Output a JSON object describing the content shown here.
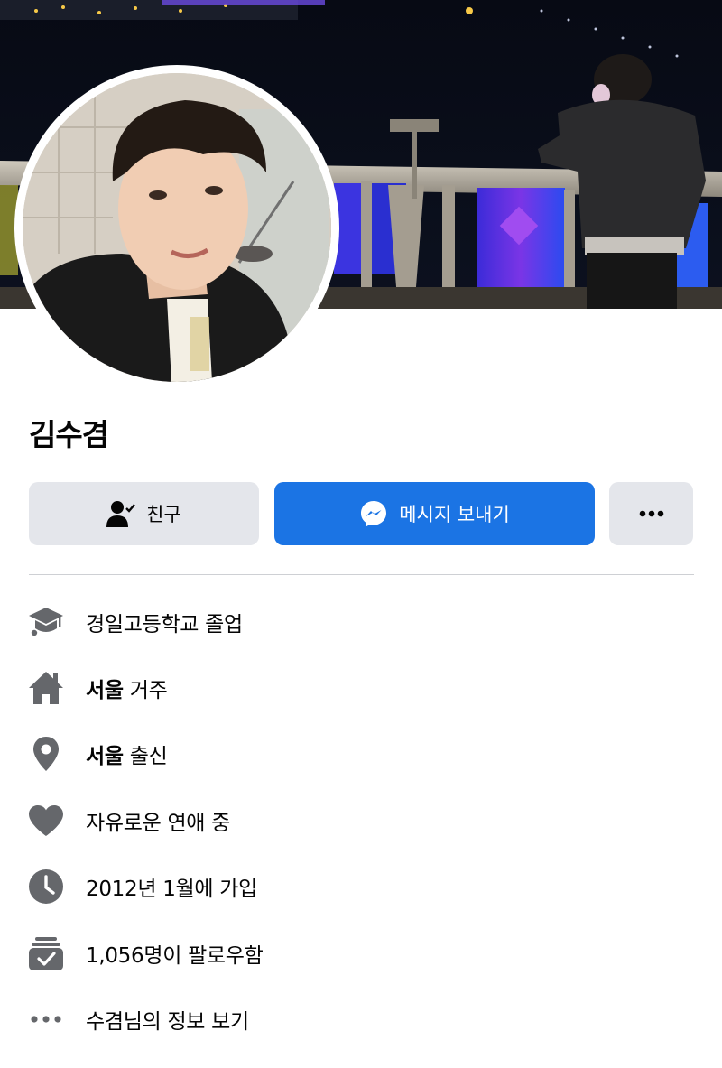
{
  "profile": {
    "name": "김수겸"
  },
  "actions": {
    "friend_label": "친구",
    "message_label": "메시지 보내기",
    "more_label": "•••"
  },
  "info": [
    {
      "icon": "graduation-cap-icon",
      "bold": "",
      "text": "경일고등학교 졸업"
    },
    {
      "icon": "home-icon",
      "bold": "서울",
      "text": " 거주"
    },
    {
      "icon": "location-pin-icon",
      "bold": "서울",
      "text": " 출신"
    },
    {
      "icon": "heart-icon",
      "bold": "",
      "text": "자유로운 연애 중"
    },
    {
      "icon": "clock-icon",
      "bold": "",
      "text": "2012년 1월에 가입"
    },
    {
      "icon": "followers-icon",
      "bold": "",
      "text": "1,056명이 팔로우함"
    },
    {
      "icon": "more-dots-icon",
      "bold": "",
      "text": "수겸님의 정보 보기"
    }
  ],
  "colors": {
    "primary_button": "#1b74e4",
    "secondary_button": "#e4e6eb",
    "icon_gray": "#65676b"
  }
}
